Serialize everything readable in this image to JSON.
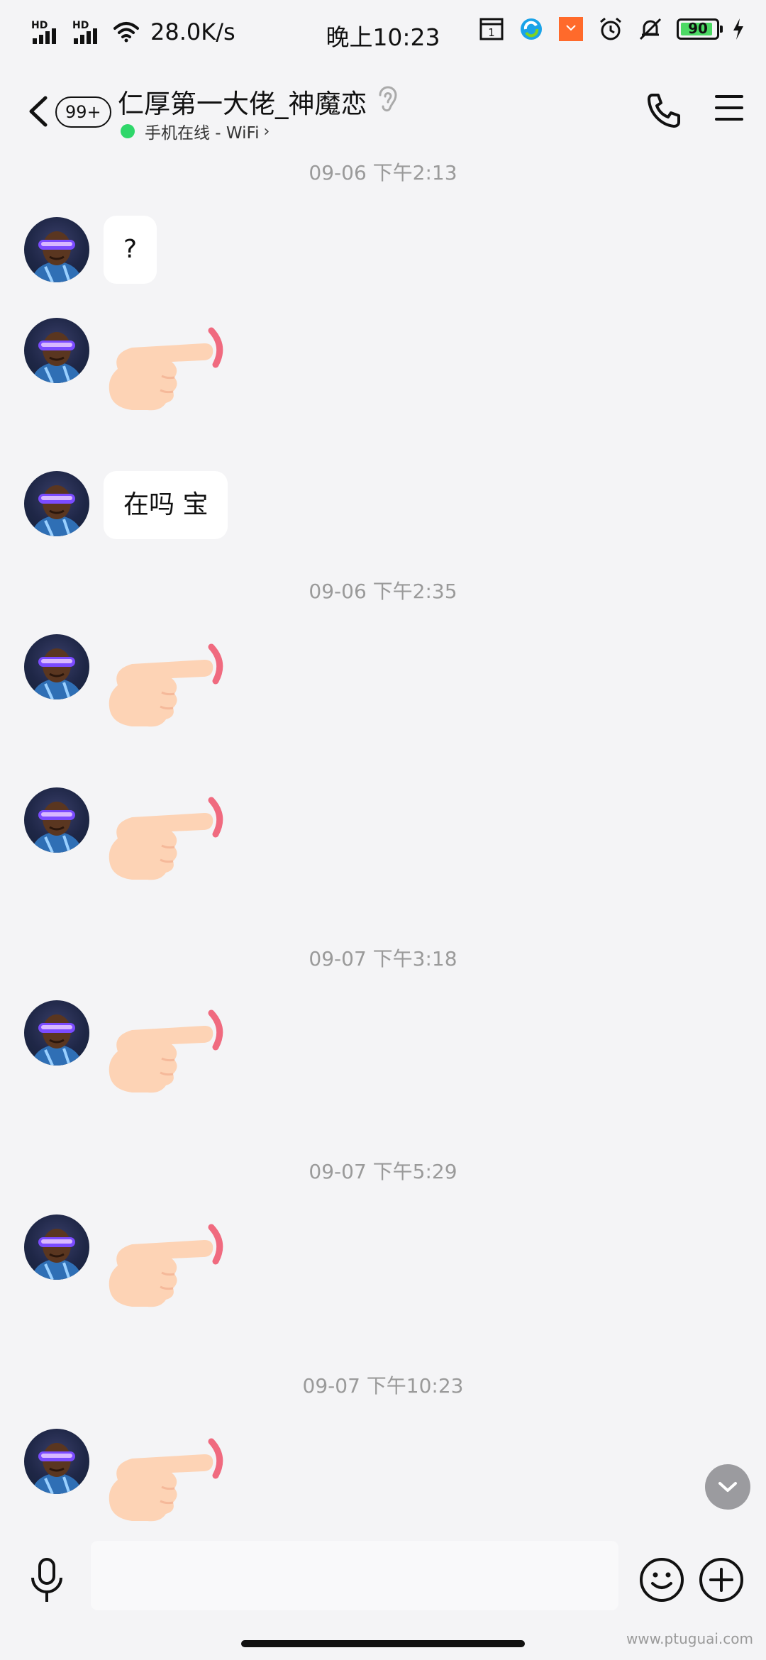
{
  "status_bar": {
    "signal_1": "HD",
    "signal_2": "HD",
    "net_speed": "28.0K/s",
    "time": "晚上10:23",
    "calendar_day": "1",
    "battery": "90"
  },
  "header": {
    "unread_badge": "99+",
    "title": "仁厚第一大佬_神魔恋",
    "subtitle": "手机在线 - WiFi",
    "subtitle_chevron": "›"
  },
  "chat": {
    "timestamps": [
      "09-06 下午2:13",
      "09-06 下午2:35",
      "09-07 下午3:18",
      "09-07 下午5:29",
      "09-07 下午10:23"
    ],
    "messages": [
      {
        "type": "text",
        "text": "?"
      },
      {
        "type": "poke"
      },
      {
        "type": "text",
        "text": "在吗  宝"
      },
      {
        "type": "poke"
      },
      {
        "type": "poke"
      },
      {
        "type": "poke"
      },
      {
        "type": "poke"
      },
      {
        "type": "poke"
      }
    ]
  },
  "icons": {
    "back": "chevron-left-icon",
    "ear": "ear-icon",
    "phone": "phone-icon",
    "menu": "menu-icon",
    "mic": "microphone-icon",
    "emoji": "emoji-icon",
    "plus": "plus-icon",
    "scroll_down": "chevron-down-icon"
  },
  "colors": {
    "online_dot": "#2fd76a",
    "background": "#f4f4f6",
    "bubble": "#ffffff",
    "battery_fill": "#4cd964"
  },
  "watermark": "www.ptuguai.com"
}
